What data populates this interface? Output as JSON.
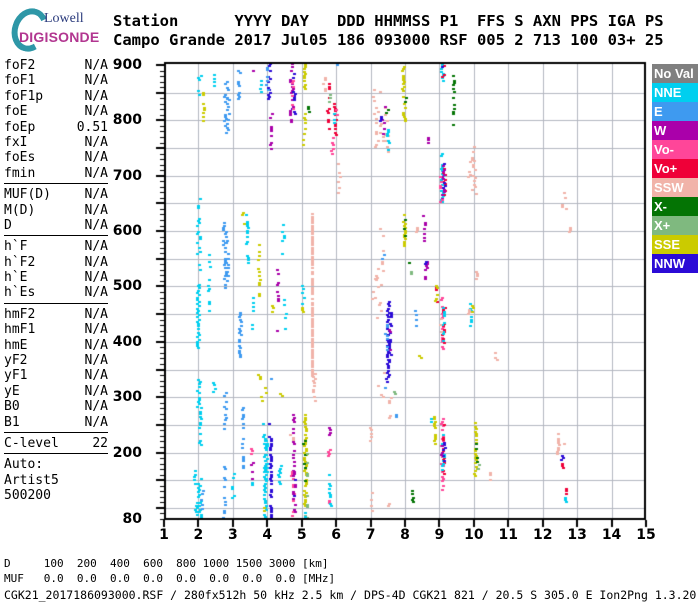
{
  "logo": {
    "brand_top": "Lowell",
    "brand_bottom": "DIGISONDE",
    "arc_color": "#2e97a7",
    "top_color": "#2a3a7c",
    "bottom_color": "#b23690"
  },
  "header": {
    "line1": "Station      YYYY DAY   DDD HHMMSS P1  FFS S AXN PPS IGA PS",
    "line2": "Campo Grande 2017 Jul05 186 093000 RSF 005 2 713 100 03+ 25",
    "fields": {
      "station": "Campo Grande",
      "yyyy": "2017",
      "day": "Jul05",
      "ddd": "186",
      "hhmmss": "093000",
      "p1": "RSF",
      "ffs": "005",
      "s": "2",
      "axn": "713",
      "pps": "100",
      "iga": "03+",
      "ps": "25"
    }
  },
  "left_panel": {
    "groups": [
      [
        {
          "label": "foF2",
          "value": "N/A"
        },
        {
          "label": "foF1",
          "value": "N/A"
        },
        {
          "label": "foF1p",
          "value": "N/A"
        },
        {
          "label": "foE",
          "value": "N/A"
        },
        {
          "label": "foEp",
          "value": "0.51"
        },
        {
          "label": "fxI",
          "value": "N/A"
        },
        {
          "label": "foEs",
          "value": "N/A"
        },
        {
          "label": "fmin",
          "value": "N/A"
        }
      ],
      [
        {
          "label": "MUF(D)",
          "value": "N/A"
        },
        {
          "label": "M(D)",
          "value": "N/A"
        },
        {
          "label": "D",
          "value": "N/A"
        }
      ],
      [
        {
          "label": "h`F",
          "value": "N/A"
        },
        {
          "label": "h`F2",
          "value": "N/A"
        },
        {
          "label": "h`E",
          "value": "N/A"
        },
        {
          "label": "h`Es",
          "value": "N/A"
        }
      ],
      [
        {
          "label": "hmF2",
          "value": "N/A"
        },
        {
          "label": "hmF1",
          "value": "N/A"
        },
        {
          "label": "hmE",
          "value": "N/A"
        },
        {
          "label": "yF2",
          "value": "N/A"
        },
        {
          "label": "yF1",
          "value": "N/A"
        },
        {
          "label": "yE",
          "value": "N/A"
        },
        {
          "label": "B0",
          "value": "N/A"
        },
        {
          "label": "B1",
          "value": "N/A"
        }
      ],
      [
        {
          "label": "C-level",
          "value": "22"
        }
      ]
    ],
    "auto_lines": [
      "Auto:",
      "Artist5",
      "500200"
    ]
  },
  "legend": [
    {
      "label": "No Val",
      "key": "noval"
    },
    {
      "label": "NNE",
      "key": "c"
    },
    {
      "label": "E",
      "key": "e"
    },
    {
      "label": "W",
      "key": "w"
    },
    {
      "label": "Vo-",
      "key": "vm"
    },
    {
      "label": "Vo+",
      "key": "vp"
    },
    {
      "label": "SSW",
      "key": "s"
    },
    {
      "label": "X-",
      "key": "xm"
    },
    {
      "label": "X+",
      "key": "xp"
    },
    {
      "label": "SSE",
      "key": "y"
    },
    {
      "label": "NNW",
      "key": "n"
    }
  ],
  "bottom_rows": {
    "d": {
      "label": "D",
      "values": [
        "100",
        "200",
        "400",
        "600",
        "800",
        "1000",
        "1500",
        "3000"
      ],
      "unit": "[km]"
    },
    "muf": {
      "label": "MUF",
      "values": [
        "0.0",
        "0.0",
        "0.0",
        "0.0",
        "0.0",
        "0.0",
        "0.0",
        "0.0"
      ],
      "unit": "[MHz]"
    }
  },
  "footer": "CGK21_2017186093000.RSF / 280fx512h 50 kHz 2.5 km / DPS-4D CGK21 821 / 20.5 S 305.0 E Ion2Png 1.3.20",
  "chart_data": {
    "type": "scatter",
    "x_unit": "MHz",
    "y_unit": "km",
    "xlim": [
      1,
      15
    ],
    "ylim": [
      80,
      900
    ],
    "x_ticks": [
      1,
      2,
      3,
      4,
      5,
      6,
      7,
      8,
      9,
      10,
      11,
      12,
      13,
      14,
      15
    ],
    "y_tick_labels": [
      900,
      800,
      700,
      600,
      500,
      400,
      300,
      200,
      80
    ],
    "grid": {
      "x_step_mhz": 1,
      "y_step_km": 50,
      "color": "#b3b7c1"
    },
    "palette": {
      "noval": "#808080",
      "c": "#00cfef",
      "e": "#3e9af0",
      "w": "#aa00aa",
      "vm": "#ff4699",
      "vp": "#ef0038",
      "s": "#f1b3a9",
      "xm": "#047404",
      "xp": "#7fb97f",
      "y": "#cbcb00",
      "n": "#2b0bd6"
    },
    "streaks_format": [
      "freq_MHz",
      "km_from",
      "km_to",
      "color_key",
      "density",
      "jitter_MHz_optional"
    ],
    "streaks": [
      [
        2.03,
        845,
        885,
        "c",
        0.65
      ],
      [
        2.15,
        790,
        850,
        "y",
        0.4
      ],
      [
        2.45,
        858,
        892,
        "c",
        0.6
      ],
      [
        2.8,
        778,
        876,
        "e",
        0.8,
        0.06
      ],
      [
        2.86,
        800,
        860,
        "e",
        0.45,
        0.05
      ],
      [
        3.15,
        838,
        892,
        "e",
        0.55,
        0.05
      ],
      [
        3.55,
        886,
        893,
        "w",
        0.9
      ],
      [
        3.8,
        848,
        876,
        "c",
        0.6
      ],
      [
        4.05,
        838,
        902,
        "n",
        0.85,
        0.04
      ],
      [
        4.0,
        855,
        895,
        "e",
        0.45
      ],
      [
        4.1,
        748,
        812,
        "w",
        0.5
      ],
      [
        4.7,
        793,
        902,
        "w",
        0.75,
        0.05
      ],
      [
        4.76,
        800,
        890,
        "n",
        0.45,
        0.05
      ],
      [
        4.72,
        820,
        872,
        "vm",
        0.3
      ],
      [
        4.78,
        884,
        897,
        "s",
        0.5
      ],
      [
        5.1,
        856,
        902,
        "y",
        0.85
      ],
      [
        5.08,
        748,
        812,
        "y",
        0.55
      ],
      [
        5.2,
        816,
        824,
        "xm",
        0.9
      ],
      [
        5.65,
        853,
        892,
        "s",
        0.5
      ],
      [
        5.78,
        773,
        866,
        "vp",
        0.45
      ],
      [
        5.88,
        728,
        770,
        "vm",
        0.5
      ],
      [
        5.83,
        833,
        846,
        "xp",
        0.6
      ],
      [
        5.97,
        773,
        832,
        "vp",
        0.5
      ],
      [
        5.94,
        788,
        822,
        "c",
        0.4
      ],
      [
        6.0,
        810,
        820,
        "vm",
        0.7
      ],
      [
        6.02,
        888,
        904,
        "e",
        0.6
      ],
      [
        6.07,
        653,
        722,
        "s",
        0.5
      ],
      [
        7.15,
        743,
        857,
        "s",
        0.45,
        0.12
      ],
      [
        7.32,
        758,
        842,
        "s",
        0.4,
        0.1
      ],
      [
        7.45,
        743,
        802,
        "s",
        0.35,
        0.08
      ],
      [
        7.36,
        768,
        832,
        "w",
        0.3,
        0.06
      ],
      [
        7.5,
        743,
        792,
        "c",
        0.5
      ],
      [
        7.28,
        798,
        807,
        "n",
        0.8
      ],
      [
        7.47,
        810,
        818,
        "xm",
        0.9
      ],
      [
        7.95,
        853,
        902,
        "y",
        0.85
      ],
      [
        7.97,
        798,
        852,
        "y",
        0.5
      ],
      [
        8.0,
        833,
        846,
        "xm",
        0.6
      ],
      [
        8.7,
        760,
        770,
        "w",
        0.9
      ],
      [
        9.08,
        868,
        906,
        "c",
        0.8
      ],
      [
        9.12,
        870,
        900,
        "vp",
        0.5
      ],
      [
        9.1,
        876,
        896,
        "n",
        0.4
      ],
      [
        9.4,
        788,
        902,
        "xm",
        0.45
      ],
      [
        9.07,
        648,
        742,
        "c",
        0.75
      ],
      [
        9.13,
        653,
        737,
        "vp",
        0.5
      ],
      [
        9.1,
        658,
        722,
        "w",
        0.4
      ],
      [
        9.12,
        678,
        732,
        "n",
        0.35
      ],
      [
        9.04,
        653,
        702,
        "vm",
        0.3
      ],
      [
        10.0,
        663,
        752,
        "s",
        0.55,
        0.05
      ],
      [
        9.85,
        698,
        708,
        "s",
        0.8
      ],
      [
        9.92,
        724,
        732,
        "s",
        0.8
      ],
      [
        12.6,
        628,
        668,
        "s",
        0.45,
        0.08
      ],
      [
        12.78,
        598,
        612,
        "s",
        0.7
      ],
      [
        1.98,
        388,
        500,
        "c",
        0.85
      ],
      [
        2.02,
        498,
        548,
        "c",
        0.4
      ],
      [
        2.0,
        558,
        662,
        "c",
        0.5
      ],
      [
        2.3,
        448,
        558,
        "c",
        0.5
      ],
      [
        2.45,
        298,
        362,
        "c",
        0.4
      ],
      [
        2.77,
        498,
        617,
        "e",
        0.75,
        0.05
      ],
      [
        2.84,
        518,
        592,
        "e",
        0.45
      ],
      [
        3.4,
        573,
        632,
        "c",
        0.55
      ],
      [
        3.45,
        543,
        562,
        "c",
        0.5
      ],
      [
        3.2,
        368,
        452,
        "e",
        0.75
      ],
      [
        3.3,
        613,
        642,
        "y",
        0.4
      ],
      [
        3.75,
        483,
        577,
        "y",
        0.5
      ],
      [
        3.6,
        423,
        482,
        "c",
        0.5
      ],
      [
        4.3,
        458,
        532,
        "w",
        0.45
      ],
      [
        4.32,
        388,
        422,
        "w",
        0.4
      ],
      [
        4.45,
        543,
        612,
        "c",
        0.5
      ],
      [
        4.5,
        423,
        482,
        "c",
        0.55
      ],
      [
        4.15,
        453,
        467,
        "y",
        0.7
      ],
      [
        5.3,
        338,
        632,
        "s",
        0.95,
        0.01
      ],
      [
        5.05,
        468,
        502,
        "c",
        0.5
      ],
      [
        5.0,
        453,
        463,
        "y",
        0.8
      ],
      [
        7.5,
        328,
        477,
        "n",
        0.85,
        0.05
      ],
      [
        7.55,
        348,
        452,
        "n",
        0.55,
        0.05
      ],
      [
        7.45,
        358,
        432,
        "e",
        0.4
      ],
      [
        7.53,
        378,
        422,
        "w",
        0.3
      ],
      [
        7.56,
        258,
        307,
        "s",
        0.5
      ],
      [
        7.3,
        300,
        345,
        "s",
        0.3,
        0.1
      ],
      [
        7.4,
        305,
        330,
        "e",
        0.4
      ],
      [
        7.67,
        306,
        312,
        "xp",
        0.8
      ],
      [
        7.77,
        260,
        272,
        "e",
        0.6
      ],
      [
        7.2,
        443,
        532,
        "s",
        0.35,
        0.12
      ],
      [
        7.05,
        478,
        522,
        "s",
        0.3,
        0.08
      ],
      [
        7.3,
        520,
        610,
        "s",
        0.3,
        0.12
      ],
      [
        7.35,
        545,
        575,
        "e",
        0.4
      ],
      [
        7.97,
        573,
        632,
        "y",
        0.8
      ],
      [
        8.0,
        588,
        622,
        "xm",
        0.4
      ],
      [
        8.55,
        583,
        632,
        "w",
        0.45
      ],
      [
        8.6,
        513,
        547,
        "w",
        0.5
      ],
      [
        8.62,
        536,
        545,
        "n",
        0.7
      ],
      [
        8.35,
        598,
        607,
        "s",
        0.8
      ],
      [
        8.15,
        538,
        549,
        "xm",
        0.7
      ],
      [
        8.17,
        518,
        528,
        "xp",
        0.7
      ],
      [
        8.9,
        490,
        500,
        "vp",
        0.9
      ],
      [
        8.3,
        428,
        477,
        "e",
        0.55
      ],
      [
        9.08,
        383,
        487,
        "vm",
        0.6
      ],
      [
        9.12,
        393,
        472,
        "vp",
        0.5
      ],
      [
        9.1,
        398,
        462,
        "c",
        0.5
      ],
      [
        9.05,
        418,
        442,
        "s",
        0.3
      ],
      [
        8.92,
        468,
        490,
        "vp",
        0.5
      ],
      [
        8.9,
        473,
        502,
        "y",
        0.6
      ],
      [
        9.9,
        428,
        477,
        "c",
        0.5
      ],
      [
        9.95,
        453,
        472,
        "y",
        0.5
      ],
      [
        9.86,
        446,
        462,
        "s",
        0.4
      ],
      [
        10.65,
        363,
        380,
        "s",
        0.6
      ],
      [
        10.1,
        510,
        530,
        "s",
        0.6
      ],
      [
        2.0,
        283,
        342,
        "c",
        0.75
      ],
      [
        2.05,
        213,
        287,
        "c",
        0.5
      ],
      [
        2.03,
        80,
        152,
        "c",
        0.75,
        0.05
      ],
      [
        1.88,
        143,
        167,
        "c",
        0.5
      ],
      [
        2.1,
        98,
        142,
        "e",
        0.4
      ],
      [
        1.92,
        80,
        122,
        "c",
        0.45
      ],
      [
        2.77,
        223,
        307,
        "e",
        0.55
      ],
      [
        2.75,
        82,
        182,
        "e",
        0.45
      ],
      [
        3.3,
        168,
        282,
        "e",
        0.65
      ],
      [
        3.0,
        118,
        162,
        "c",
        0.5
      ],
      [
        3.55,
        153,
        197,
        "w",
        0.5
      ],
      [
        3.58,
        113,
        152,
        "c",
        0.5
      ],
      [
        3.52,
        198,
        207,
        "vm",
        0.8
      ],
      [
        3.76,
        328,
        342,
        "y",
        0.6
      ],
      [
        3.8,
        293,
        303,
        "y",
        0.7
      ],
      [
        3.93,
        80,
        227,
        "c",
        0.8,
        0.03
      ],
      [
        3.97,
        148,
        222,
        "c",
        0.45
      ],
      [
        3.9,
        228,
        262,
        "c",
        0.4
      ],
      [
        3.95,
        308,
        318,
        "y",
        0.7
      ],
      [
        3.88,
        95,
        102,
        "y",
        0.8
      ],
      [
        4.1,
        80,
        227,
        "n",
        0.85,
        0.02
      ],
      [
        4.08,
        228,
        252,
        "n",
        0.4
      ],
      [
        4.12,
        333,
        343,
        "e",
        0.7
      ],
      [
        4.35,
        143,
        177,
        "c",
        0.55
      ],
      [
        4.38,
        298,
        308,
        "y",
        0.6
      ],
      [
        4.75,
        163,
        272,
        "w",
        0.75
      ],
      [
        4.73,
        85,
        167,
        "vm",
        0.5
      ],
      [
        4.78,
        98,
        162,
        "n",
        0.4
      ],
      [
        4.77,
        93,
        167,
        "w",
        0.45
      ],
      [
        4.7,
        223,
        247,
        "s",
        0.5
      ],
      [
        5.1,
        103,
        267,
        "y",
        0.8
      ],
      [
        5.07,
        148,
        227,
        "xm",
        0.35
      ],
      [
        5.13,
        118,
        202,
        "xp",
        0.3
      ],
      [
        5.13,
        82,
        108,
        "xp",
        0.6
      ],
      [
        5.1,
        83,
        100,
        "c",
        0.5
      ],
      [
        5.35,
        293,
        342,
        "s",
        0.6
      ],
      [
        5.8,
        228,
        252,
        "w",
        0.55
      ],
      [
        5.78,
        193,
        207,
        "vm",
        0.7
      ],
      [
        5.79,
        108,
        114,
        "vm",
        0.9
      ],
      [
        5.82,
        83,
        167,
        "c",
        0.55
      ],
      [
        7.0,
        193,
        247,
        "s",
        0.55
      ],
      [
        7.02,
        83,
        127,
        "s",
        0.45
      ],
      [
        7.5,
        83,
        122,
        "s",
        0.35
      ],
      [
        9.08,
        148,
        262,
        "vm",
        0.65
      ],
      [
        9.12,
        158,
        252,
        "vp",
        0.5
      ],
      [
        9.1,
        168,
        247,
        "c",
        0.5
      ],
      [
        9.13,
        173,
        232,
        "n",
        0.35
      ],
      [
        9.05,
        183,
        217,
        "w",
        0.3
      ],
      [
        9.1,
        128,
        147,
        "vm",
        0.5
      ],
      [
        8.85,
        212,
        264,
        "y",
        0.7
      ],
      [
        8.73,
        256,
        262,
        "c",
        0.8
      ],
      [
        8.44,
        370,
        377,
        "y",
        0.8
      ],
      [
        10.05,
        158,
        257,
        "y",
        0.75
      ],
      [
        10.07,
        183,
        217,
        "xm",
        0.45
      ],
      [
        10.15,
        170,
        180,
        "xp",
        0.7
      ],
      [
        8.23,
        106,
        136,
        "xm",
        0.55
      ],
      [
        12.45,
        193,
        240,
        "s",
        0.55
      ],
      [
        12.62,
        208,
        218,
        "s",
        0.8
      ],
      [
        12.56,
        186,
        194,
        "n",
        0.9
      ],
      [
        12.56,
        172,
        180,
        "vp",
        0.9
      ],
      [
        12.68,
        126,
        135,
        "vp",
        0.9
      ],
      [
        12.68,
        110,
        118,
        "c",
        0.9
      ],
      [
        10.47,
        151,
        166,
        "s",
        0.6
      ]
    ]
  }
}
